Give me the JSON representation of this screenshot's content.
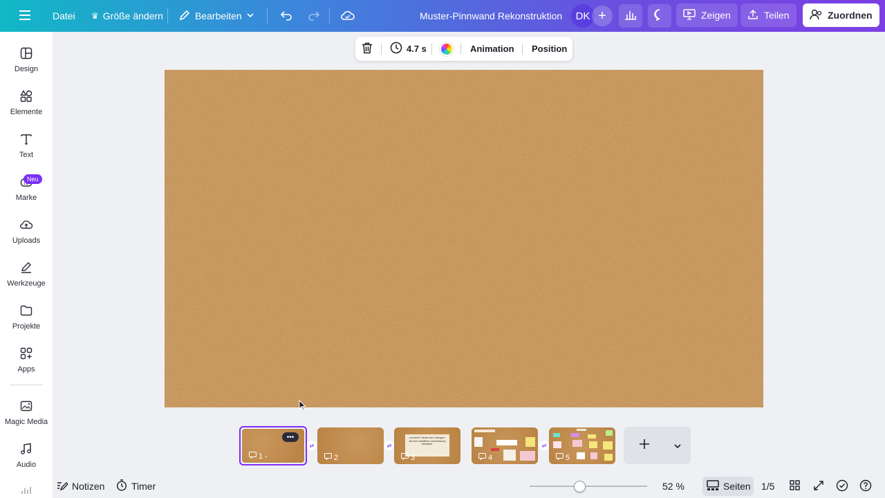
{
  "topbar": {
    "menu_icon": "hamburger-icon",
    "file_label": "Datei",
    "resize_label": "Größe ändern",
    "edit_label": "Bearbeiten",
    "doc_title": "Muster-Pinnwand Rekonstruktion",
    "avatar_initials": "DK",
    "present_label": "Zeigen",
    "share_label": "Teilen",
    "assign_label": "Zuordnen"
  },
  "sidebar": {
    "items": [
      {
        "label": "Design",
        "icon": "layout-icon"
      },
      {
        "label": "Elemente",
        "icon": "shapes-icon"
      },
      {
        "label": "Text",
        "icon": "text-icon"
      },
      {
        "label": "Marke",
        "icon": "brand-icon",
        "badge": "Neu"
      },
      {
        "label": "Uploads",
        "icon": "cloud-upload-icon"
      },
      {
        "label": "Werkzeuge",
        "icon": "pen-icon"
      },
      {
        "label": "Projekte",
        "icon": "folder-icon"
      },
      {
        "label": "Apps",
        "icon": "apps-icon"
      },
      {
        "label": "Magic Media",
        "icon": "magic-media-icon"
      },
      {
        "label": "Audio",
        "icon": "music-icon"
      }
    ]
  },
  "floating_toolbar": {
    "duration": "4.7 s",
    "animation_label": "Animation",
    "position_label": "Position"
  },
  "canvas": {
    "background": "cork-board"
  },
  "pages": {
    "thumbnails": [
      {
        "number": "1 -",
        "active": true
      },
      {
        "number": "2",
        "active": false
      },
      {
        "number": "3",
        "active": false,
        "text": "Lernstufe 3 findet hier Leitfragen, die eine inhaltliche Unterstützung darstellen."
      },
      {
        "number": "4",
        "active": false
      },
      {
        "number": "5",
        "active": false
      }
    ]
  },
  "bottombar": {
    "notes_label": "Notizen",
    "timer_label": "Timer",
    "zoom_percent": "52 %",
    "zoom_level": 0.52,
    "pages_label": "Seiten",
    "page_counter": "1/5"
  },
  "colors": {
    "accent": "#7b2ff7",
    "cork": "#c08a4c"
  }
}
